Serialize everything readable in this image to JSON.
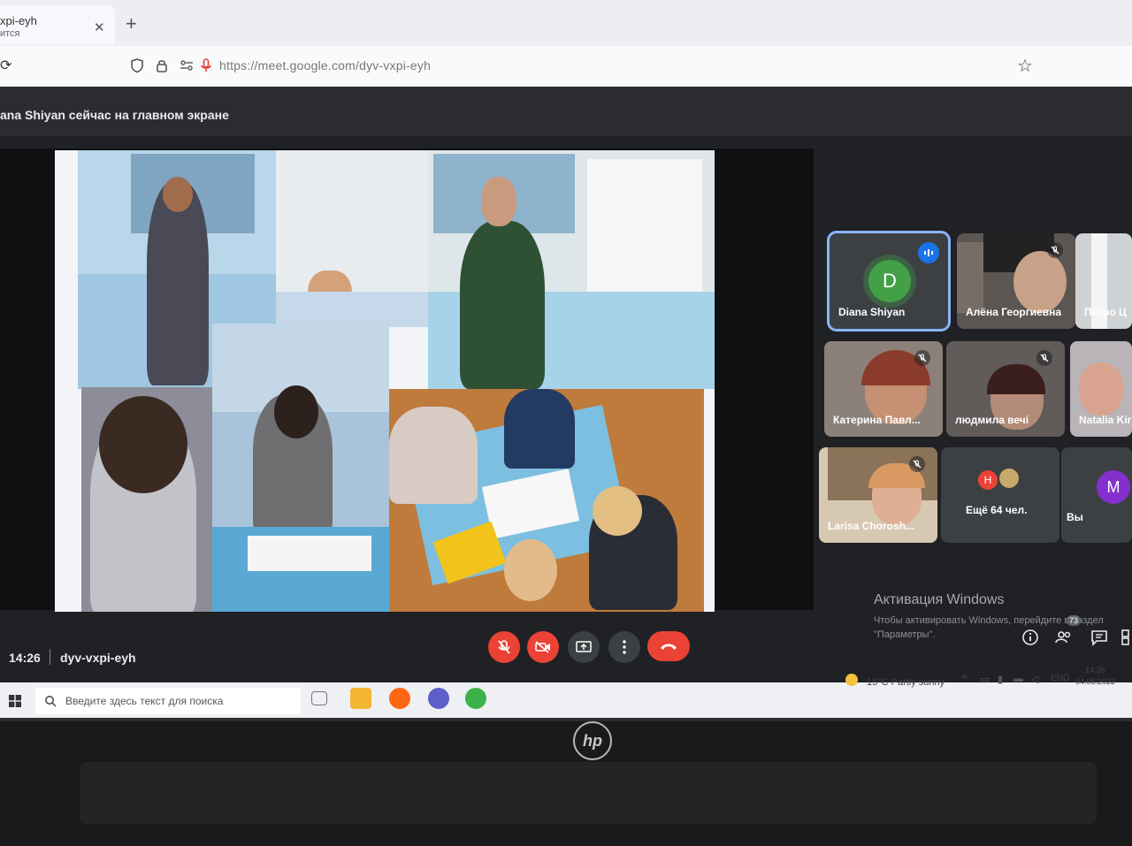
{
  "browser": {
    "tab": {
      "title": "xpi-eyh",
      "subtitle": "ится"
    },
    "address": "https://meet.google.com/dyv-vxpi-eyh"
  },
  "meet": {
    "presenting_banner": "ana Shiyan сейчас на главном экране",
    "time": "14:26",
    "meeting_code": "dyv-vxpi-eyh",
    "participants_count": "73",
    "tiles": [
      {
        "name": "Diana Shiyan",
        "avatar_letter": "D",
        "avatar_color": "#43a047",
        "speaking": true
      },
      {
        "name": "Алёна Георгиевна",
        "muted": true
      },
      {
        "name": "Петро Ц"
      },
      {
        "name": "Катерина Павл...",
        "muted": true
      },
      {
        "name": "людмила вечі",
        "muted": true
      },
      {
        "name": "Natalia Kir"
      },
      {
        "name": "Larisa Chorosh...",
        "muted": true
      },
      {
        "name": "Ещё 64 чел.",
        "avatar_letter": "H",
        "avatar_color": "#ea4335"
      },
      {
        "name": "Вы",
        "avatar_letter": "M",
        "avatar_color": "#8430ce"
      }
    ],
    "activation": {
      "title": "Активация Windows",
      "subtitle": "Чтобы активировать Windows, перейдите в раздел \"Параметры\"."
    }
  },
  "taskbar": {
    "search_placeholder": "Введите здесь текст для поиска",
    "weather": "15°C  Partly sunny",
    "language": "ENG",
    "clock_time": "14:26",
    "clock_date": "04.05.2022"
  },
  "device": {
    "logo": "hp"
  }
}
